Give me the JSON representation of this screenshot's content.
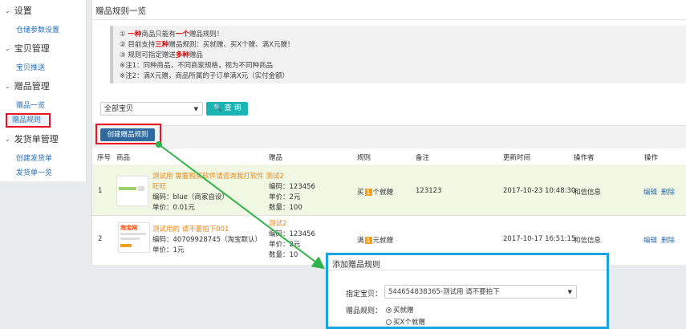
{
  "sidebar": {
    "groups": [
      {
        "label": "设置",
        "items": [
          "仓储参数设置"
        ]
      },
      {
        "label": "宝贝管理",
        "items": [
          "宝贝推送"
        ]
      },
      {
        "label": "赠品管理",
        "items": [
          "赠品一览",
          "赠品规则"
        ]
      },
      {
        "label": "发货单管理",
        "items": [
          "创建发货单",
          "发货单一览"
        ]
      }
    ]
  },
  "page": {
    "title": "赠品规则一览"
  },
  "notes": [
    {
      "pre": "① ",
      "hl": "一种",
      "mid": "商品只能有",
      "hl2": "一个",
      "post": "赠品规则！"
    },
    {
      "pre": "② 目前支持",
      "hl": "三种",
      "mid": "赠品规则：买就赠、买X个赠、满X元赠！",
      "hl2": "",
      "post": ""
    },
    {
      "pre": "③ 规则可指定赠送",
      "hl": "多种",
      "mid": "赠品",
      "hl2": "",
      "post": ""
    },
    {
      "pre": "※注1：同种商品，不同商家规格，视为不同种商品",
      "hl": "",
      "mid": "",
      "hl2": "",
      "post": ""
    },
    {
      "pre": "※注2：满X元赠，商品所属的子订单满X元（实付金额）",
      "hl": "",
      "mid": "",
      "hl2": "",
      "post": ""
    }
  ],
  "filter": {
    "select_value": "全部宝贝",
    "query_label": "查 询"
  },
  "toolbar": {
    "create_label": "创建赠品规则"
  },
  "table": {
    "headers": [
      "序号",
      "商品",
      "赠品",
      "规则",
      "备注",
      "更新时间",
      "操作者",
      "操作"
    ],
    "rows": [
      {
        "index": "1",
        "product_name": "测试用 需要购买软件请咨询我打软件 测试2 旺旺",
        "product_name_a": "测试用 需要购买软件请咨询我打软件 测试2",
        "product_name_b": "旺旺",
        "product_code": "编码：blue（商家自设）",
        "product_price": "单价：0.01元",
        "gift_code": "编码：123456",
        "gift_price": "单价：2元",
        "gift_qty": "数量：100",
        "rule_pre": "买",
        "rule_badge": "1",
        "rule_post": "个就赠",
        "remark": "123123",
        "updated": "2017-10-23 10:48:30",
        "operator": "和信信息",
        "edit": "编辑",
        "delete": "删除"
      },
      {
        "index": "2",
        "product_logo": "淘宝网",
        "product_name": "测试用的 请不要拍下001",
        "product_code": "编码：40709928745（淘宝默认）",
        "product_price": "单价：1元",
        "gift_name": "测试2",
        "gift_code": "编码：123456",
        "gift_price": "单价：2元",
        "gift_qty": "数量：10",
        "rule_pre": "满",
        "rule_badge": "1",
        "rule_post": "元就赠",
        "remark": "",
        "updated": "2017-10-17 16:51:15",
        "operator": "和信信息",
        "edit": "编辑",
        "delete": "删除"
      }
    ]
  },
  "dialog": {
    "title": "添加赠品规则",
    "product_label": "指定宝贝：",
    "product_value": "544654838365-测试用 请不要拍下",
    "rule_label": "赠品规则：",
    "options": [
      "买就赠",
      "买X个就赠"
    ]
  },
  "colors": {
    "accent": "#1bb3b3",
    "primary": "#2f6a9e",
    "highlight_border": "#ee1122",
    "dialog_border": "#1aa3e0",
    "arrow": "#2fb34a"
  }
}
